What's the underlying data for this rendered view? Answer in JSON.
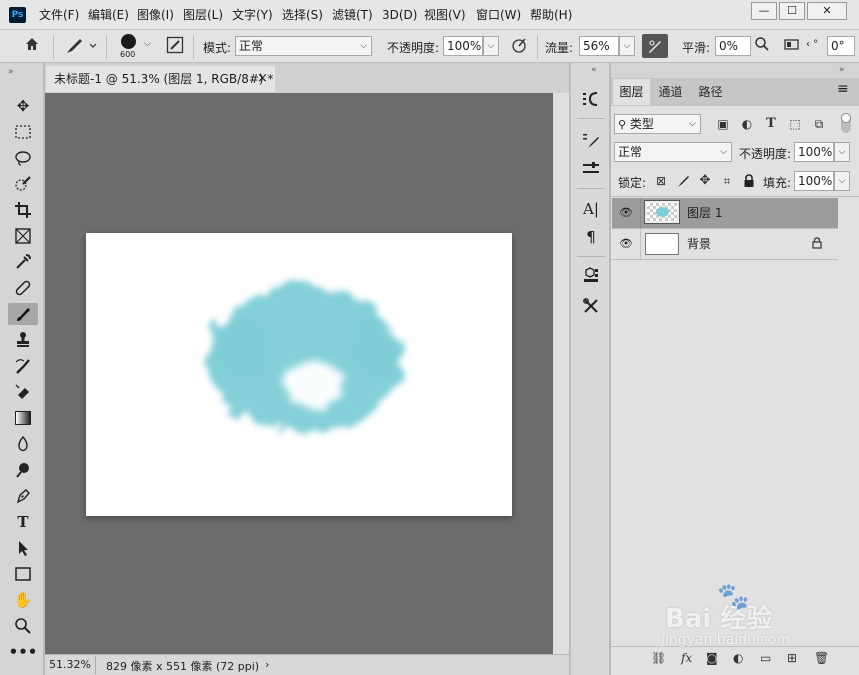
{
  "app": {
    "logo": "Ps"
  },
  "menu": [
    "文件(F)",
    "编辑(E)",
    "图像(I)",
    "图层(L)",
    "文字(Y)",
    "选择(S)",
    "滤镜(T)",
    "3D(D)",
    "视图(V)",
    "窗口(W)",
    "帮助(H)"
  ],
  "window_controls": {
    "minimize": "—",
    "maximize": "☐",
    "close": "✕"
  },
  "options": {
    "brush_size": "600",
    "mode_label": "模式:",
    "mode_value": "正常",
    "opacity_label": "不透明度:",
    "opacity_value": "100%",
    "flow_label": "流量:",
    "flow_value": "56%",
    "smooth_label": "平滑:",
    "smooth_value": "0%",
    "angle_value": "0°"
  },
  "document": {
    "tab_title": "未标题-1 @ 51.3% (图层 1, RGB/8#) *",
    "close": "×",
    "zoom": "51.32%",
    "size_info": "829 像素 x 551 像素 (72 ppi)",
    "status_arrow": "›"
  },
  "layers_panel": {
    "tabs": [
      "图层",
      "通道",
      "路径"
    ],
    "filter_label": "类型",
    "blend_value": "正常",
    "opacity_label": "不透明度:",
    "opacity_value": "100%",
    "lock_label": "锁定:",
    "fill_label": "填充:",
    "fill_value": "100%",
    "layers": [
      {
        "name": "图层 1",
        "selected": true
      },
      {
        "name": "背景",
        "selected": false
      }
    ]
  },
  "colors": {
    "paint": "#7dced6",
    "canvas_bg": "#6c6c6c",
    "selected_layer": "#9c9c9c"
  },
  "watermark": {
    "brand": "Bai 经验",
    "url": "jingyan.baidu.com"
  }
}
